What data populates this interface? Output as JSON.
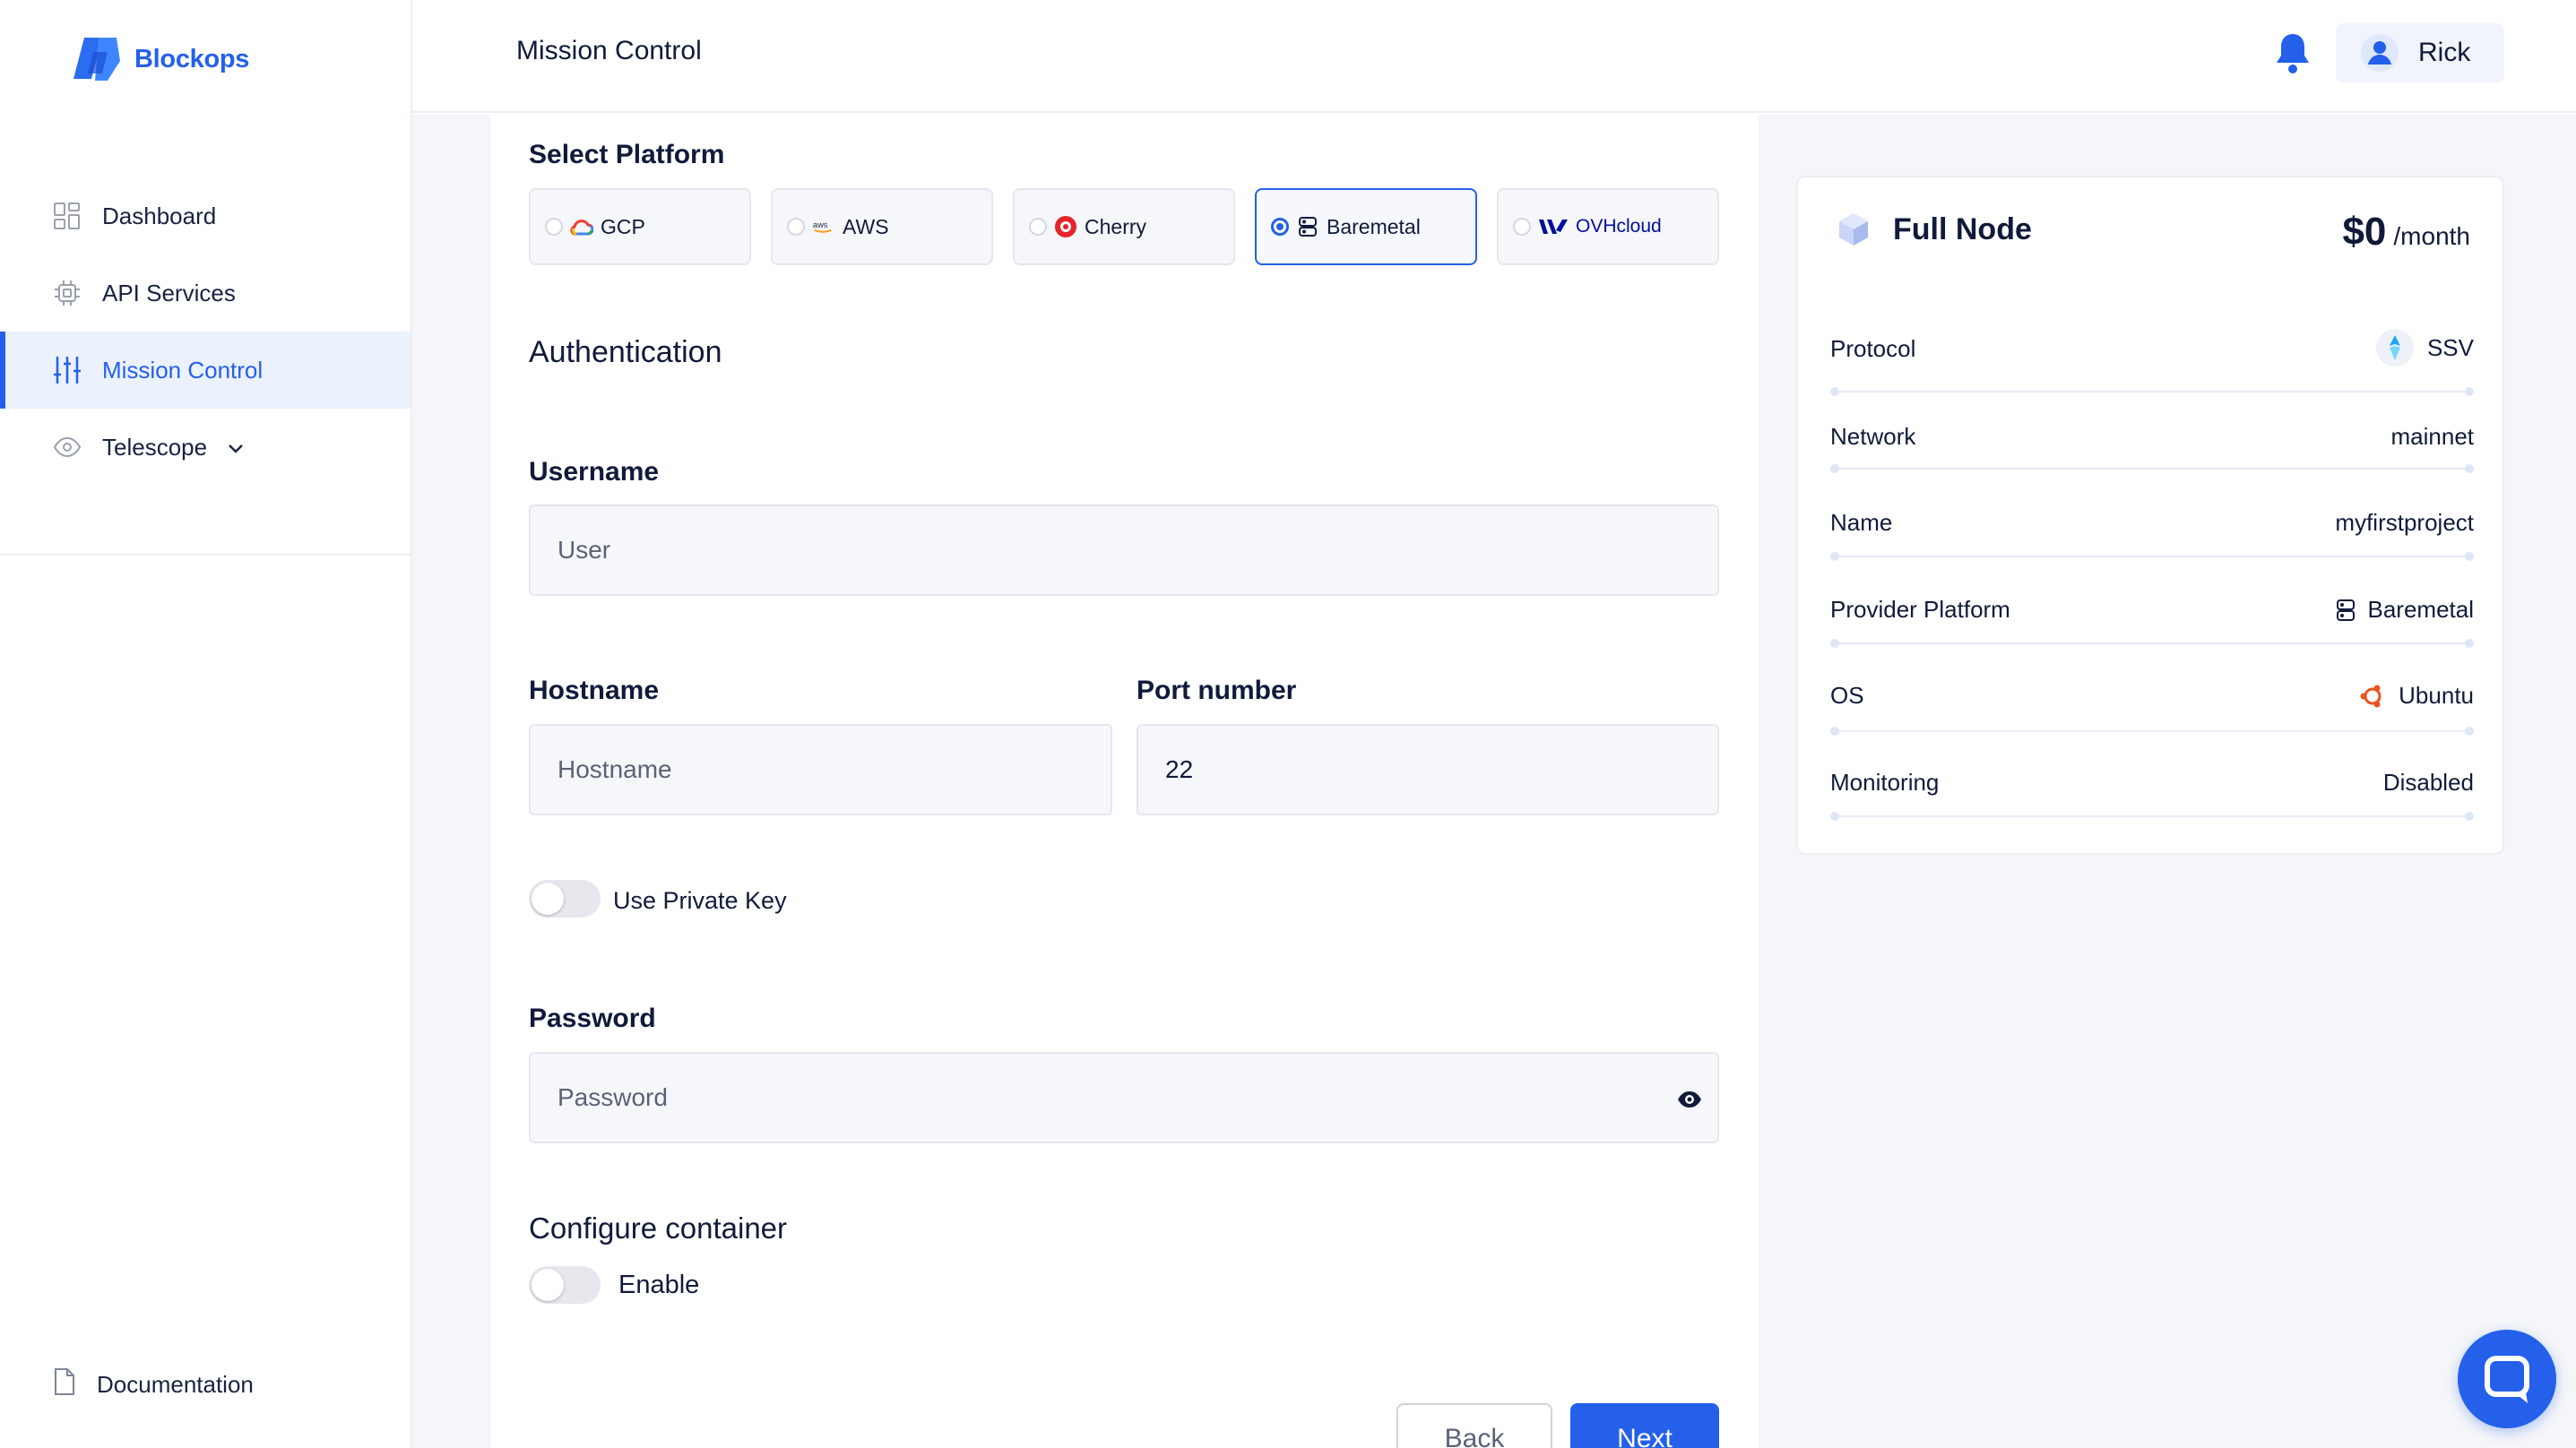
{
  "app": {
    "brand": "Blockops"
  },
  "header": {
    "title": "Mission Control",
    "user_name": "Rick"
  },
  "sidebar": {
    "items": [
      {
        "label": "Dashboard",
        "icon": "dashboard-grid-icon",
        "active": false
      },
      {
        "label": "API Services",
        "icon": "chip-icon",
        "active": false
      },
      {
        "label": "Mission Control",
        "icon": "sliders-icon",
        "active": true
      },
      {
        "label": "Telescope",
        "icon": "eye-icon",
        "active": false,
        "expandable": true
      }
    ],
    "documentation": "Documentation"
  },
  "form": {
    "platform_label": "Select Platform",
    "platforms": [
      {
        "label": "GCP",
        "icon": "gcp-cloud-icon",
        "selected": false
      },
      {
        "label": "AWS",
        "icon": "aws-logo-icon",
        "selected": false
      },
      {
        "label": "Cherry",
        "icon": "cherry-logo-icon",
        "selected": false
      },
      {
        "label": "Baremetal",
        "icon": "server-icon",
        "selected": true
      },
      {
        "label": "OVHcloud",
        "icon": "ovh-logo-icon",
        "selected": false
      }
    ],
    "auth_heading": "Authentication",
    "username": {
      "label": "Username",
      "placeholder": "User",
      "value": ""
    },
    "hostname": {
      "label": "Hostname",
      "placeholder": "Hostname",
      "value": ""
    },
    "port": {
      "label": "Port number",
      "value": "22"
    },
    "private_key": {
      "label": "Use Private Key",
      "enabled": false
    },
    "password": {
      "label": "Password",
      "placeholder": "Password",
      "value": ""
    },
    "container": {
      "heading": "Configure container",
      "toggle_label": "Enable",
      "enabled": false
    },
    "back_label": "Back",
    "next_label": "Next"
  },
  "summary": {
    "title": "Full Node",
    "price": "$0",
    "price_unit": "/month",
    "rows": [
      {
        "label": "Protocol",
        "value": "SSV",
        "icon": "ssv-logo-icon"
      },
      {
        "label": "Network",
        "value": "mainnet"
      },
      {
        "label": "Name",
        "value": "myfirstproject"
      },
      {
        "label": "Provider Platform",
        "value": "Baremetal",
        "icon": "server-icon"
      },
      {
        "label": "OS",
        "value": "Ubuntu",
        "icon": "ubuntu-logo-icon"
      },
      {
        "label": "Monitoring",
        "value": "Disabled"
      }
    ]
  },
  "colors": {
    "accent": "#2460ea",
    "text": "#111a3a",
    "panel_bg": "#f5f6f9"
  }
}
